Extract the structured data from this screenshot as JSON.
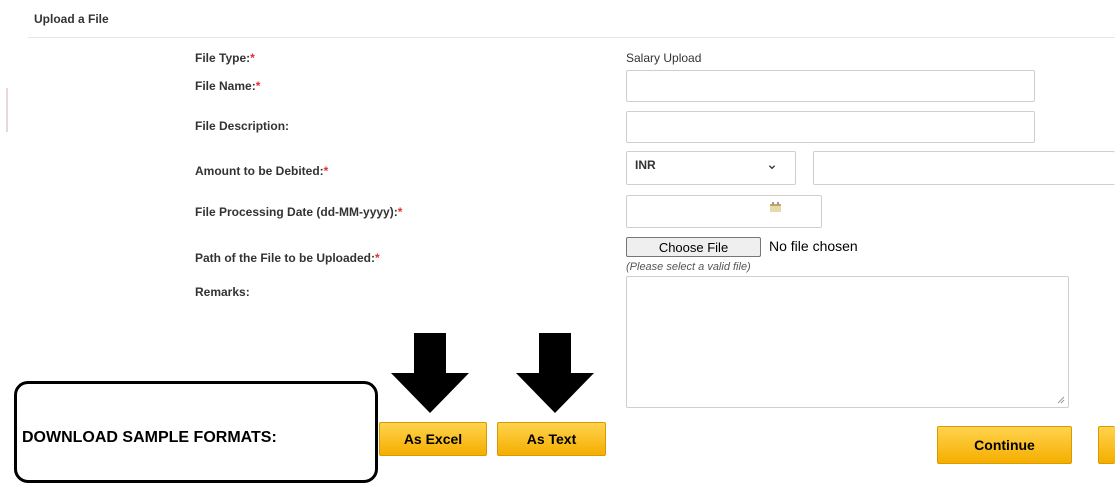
{
  "section_title": "Upload a File",
  "form": {
    "file_type": {
      "label": "File Type:",
      "required": "*",
      "value": "Salary Upload"
    },
    "file_name": {
      "label": "File Name:",
      "required": "*",
      "value": ""
    },
    "file_description": {
      "label": "File Description:",
      "value": ""
    },
    "amount": {
      "label": "Amount to be Debited:",
      "required": "*",
      "currency": "INR",
      "value": ""
    },
    "processing_date": {
      "label": "File Processing Date (dd-MM-yyyy):",
      "required": "*",
      "value": ""
    },
    "file_path": {
      "label": "Path of the File to be Uploaded:",
      "required": "*",
      "button": "Choose File",
      "status": "No file chosen",
      "hint": "(Please select a valid file)"
    },
    "remarks": {
      "label": "Remarks:",
      "value": ""
    }
  },
  "download": {
    "label": "DOWNLOAD SAMPLE FORMATS:",
    "excel_button": "As Excel",
    "text_button": "As Text"
  },
  "actions": {
    "continue_button": "Continue"
  },
  "colors": {
    "button_yellow": "#f5ae00",
    "required_red": "#e03030",
    "arrow": "#000000"
  }
}
